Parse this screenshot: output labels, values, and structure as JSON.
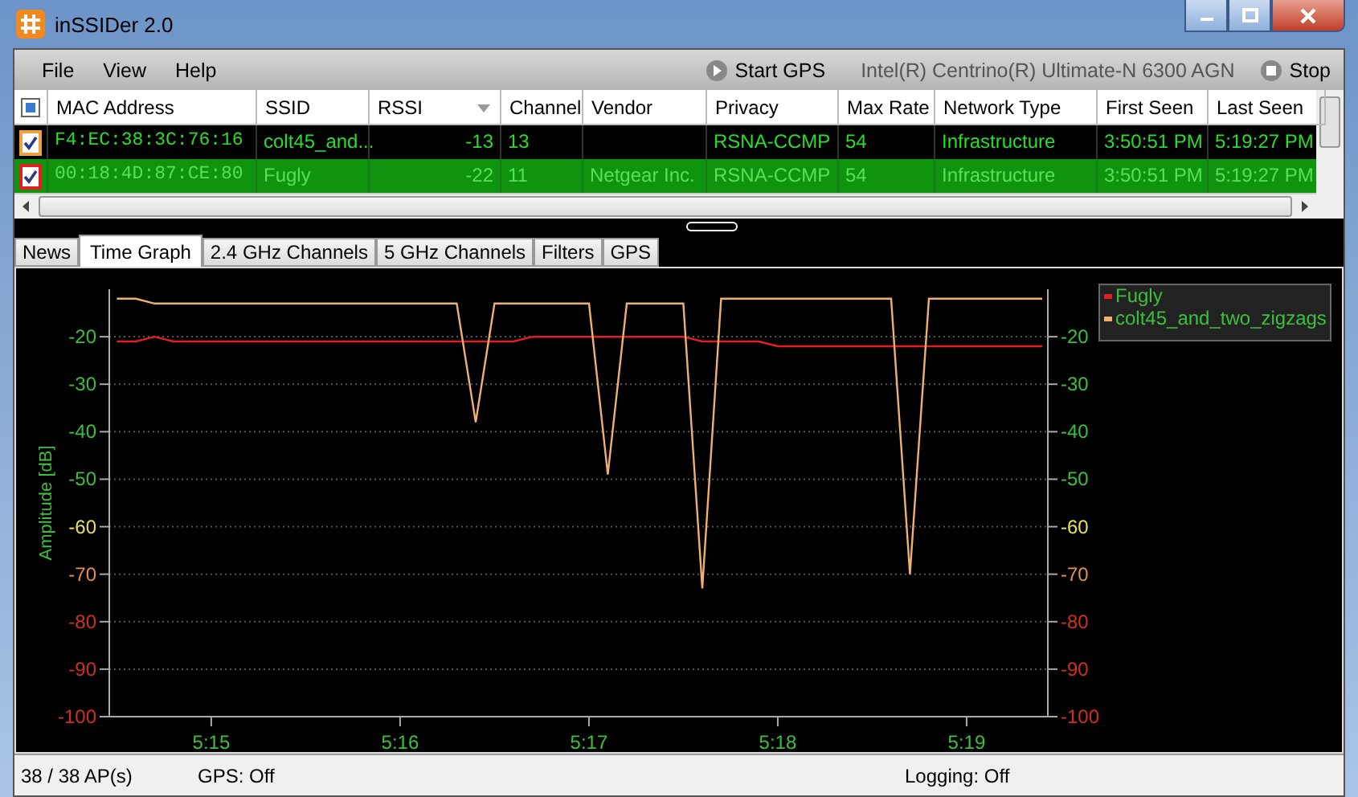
{
  "window": {
    "title": "inSSIDer 2.0"
  },
  "menu": [
    "File",
    "View",
    "Help"
  ],
  "toolbar": {
    "start_gps": "Start GPS",
    "adapter": "Intel(R) Centrino(R) Ultimate-N 6300 AGN",
    "stop": "Stop"
  },
  "table": {
    "select_all": {
      "indeterminate": true
    },
    "columns": [
      "MAC Address",
      "SSID",
      "RSSI",
      "Channel",
      "Vendor",
      "Privacy",
      "Max Rate",
      "Network Type",
      "First Seen",
      "Last Seen"
    ],
    "rows": [
      {
        "checked": true,
        "selected": false,
        "color": "#f0a040",
        "cells": [
          "F4:EC:38:3C:76:16",
          "colt45_and...",
          "-13",
          "13",
          null,
          "RSNA-CCMP",
          "54",
          "Infrastructure",
          "3:50:51 PM",
          "5:19:27 PM"
        ]
      },
      {
        "checked": true,
        "selected": true,
        "color": "#e02020",
        "cells": [
          "00:18:4D:87:CE:80",
          "Fugly",
          "-22",
          "11",
          "Netgear Inc.",
          "RSNA-CCMP",
          "54",
          "Infrastructure",
          "3:50:51 PM",
          "5:19:27 PM"
        ]
      }
    ]
  },
  "tabs": [
    {
      "label": "News",
      "selected": false
    },
    {
      "label": "Time Graph",
      "selected": true
    },
    {
      "label": "2.4 GHz Channels",
      "selected": false
    },
    {
      "label": "5 GHz Channels",
      "selected": false
    },
    {
      "label": "Filters",
      "selected": false
    },
    {
      "label": "GPS",
      "selected": false
    }
  ],
  "chart_data": {
    "type": "line",
    "ylabel": "Amplitude [dB]",
    "categories": [
      null,
      null,
      null,
      null,
      null,
      "5:15",
      null,
      null,
      null,
      null,
      null,
      null,
      null,
      null,
      null,
      "5:16",
      null,
      null,
      null,
      null,
      null,
      null,
      null,
      null,
      null,
      "5:17",
      null,
      null,
      null,
      null,
      null,
      null,
      null,
      null,
      null,
      "5:18",
      null,
      null,
      null,
      null,
      null,
      null,
      null,
      null,
      null,
      "5:19",
      null,
      null,
      null,
      null
    ],
    "series": [
      {
        "name": "Fugly",
        "color": "#e02020",
        "values": [
          -21,
          -21,
          -20,
          -21,
          -21,
          -21,
          -21,
          -21,
          -21,
          -21,
          -21,
          -21,
          -21,
          -21,
          -21,
          -21,
          -21,
          -21,
          -21,
          -21,
          -21,
          -21,
          -20,
          -20,
          -20,
          -20,
          -20,
          -20,
          -20,
          -20,
          -20,
          -21,
          -21,
          -21,
          -21,
          -22,
          -22,
          -22,
          -22,
          -22,
          -22,
          -22,
          -22,
          -22,
          -22,
          -22,
          -22,
          -22,
          -22,
          -22
        ]
      },
      {
        "name": "colt45_and_two_zigzags",
        "color": "#f0b070",
        "values": [
          -12,
          -12,
          -13,
          -13,
          -13,
          -13,
          -13,
          -13,
          -13,
          -13,
          -13,
          -13,
          -13,
          -13,
          -13,
          -13,
          -13,
          -13,
          -13,
          -38,
          -13,
          -13,
          -13,
          -13,
          -13,
          -13,
          -49,
          -13,
          -13,
          -13,
          -13,
          -73,
          -12,
          -12,
          -12,
          -12,
          -12,
          -12,
          -12,
          -12,
          -12,
          -12,
          -70,
          -12,
          -12,
          -12,
          -12,
          -12,
          -12,
          -12
        ]
      }
    ],
    "ylim": [
      -100,
      -10
    ],
    "yticks": [
      -20,
      -30,
      -40,
      -50,
      -60,
      -70,
      -80,
      -90,
      -100
    ],
    "grid": true,
    "legend": true
  },
  "left_axis_labels": [
    "-20",
    "-30",
    "-40",
    "-50",
    "-60",
    "-70",
    "-80",
    "-90",
    "-100"
  ],
  "right_axis_labels": [
    "-20",
    "-30",
    "-40",
    "-50",
    "-60",
    "-70",
    "-80",
    "-90",
    "-100"
  ],
  "status_bar": [
    "38 / 38 AP(s)",
    "GPS: Off",
    "Logging: Off"
  ]
}
